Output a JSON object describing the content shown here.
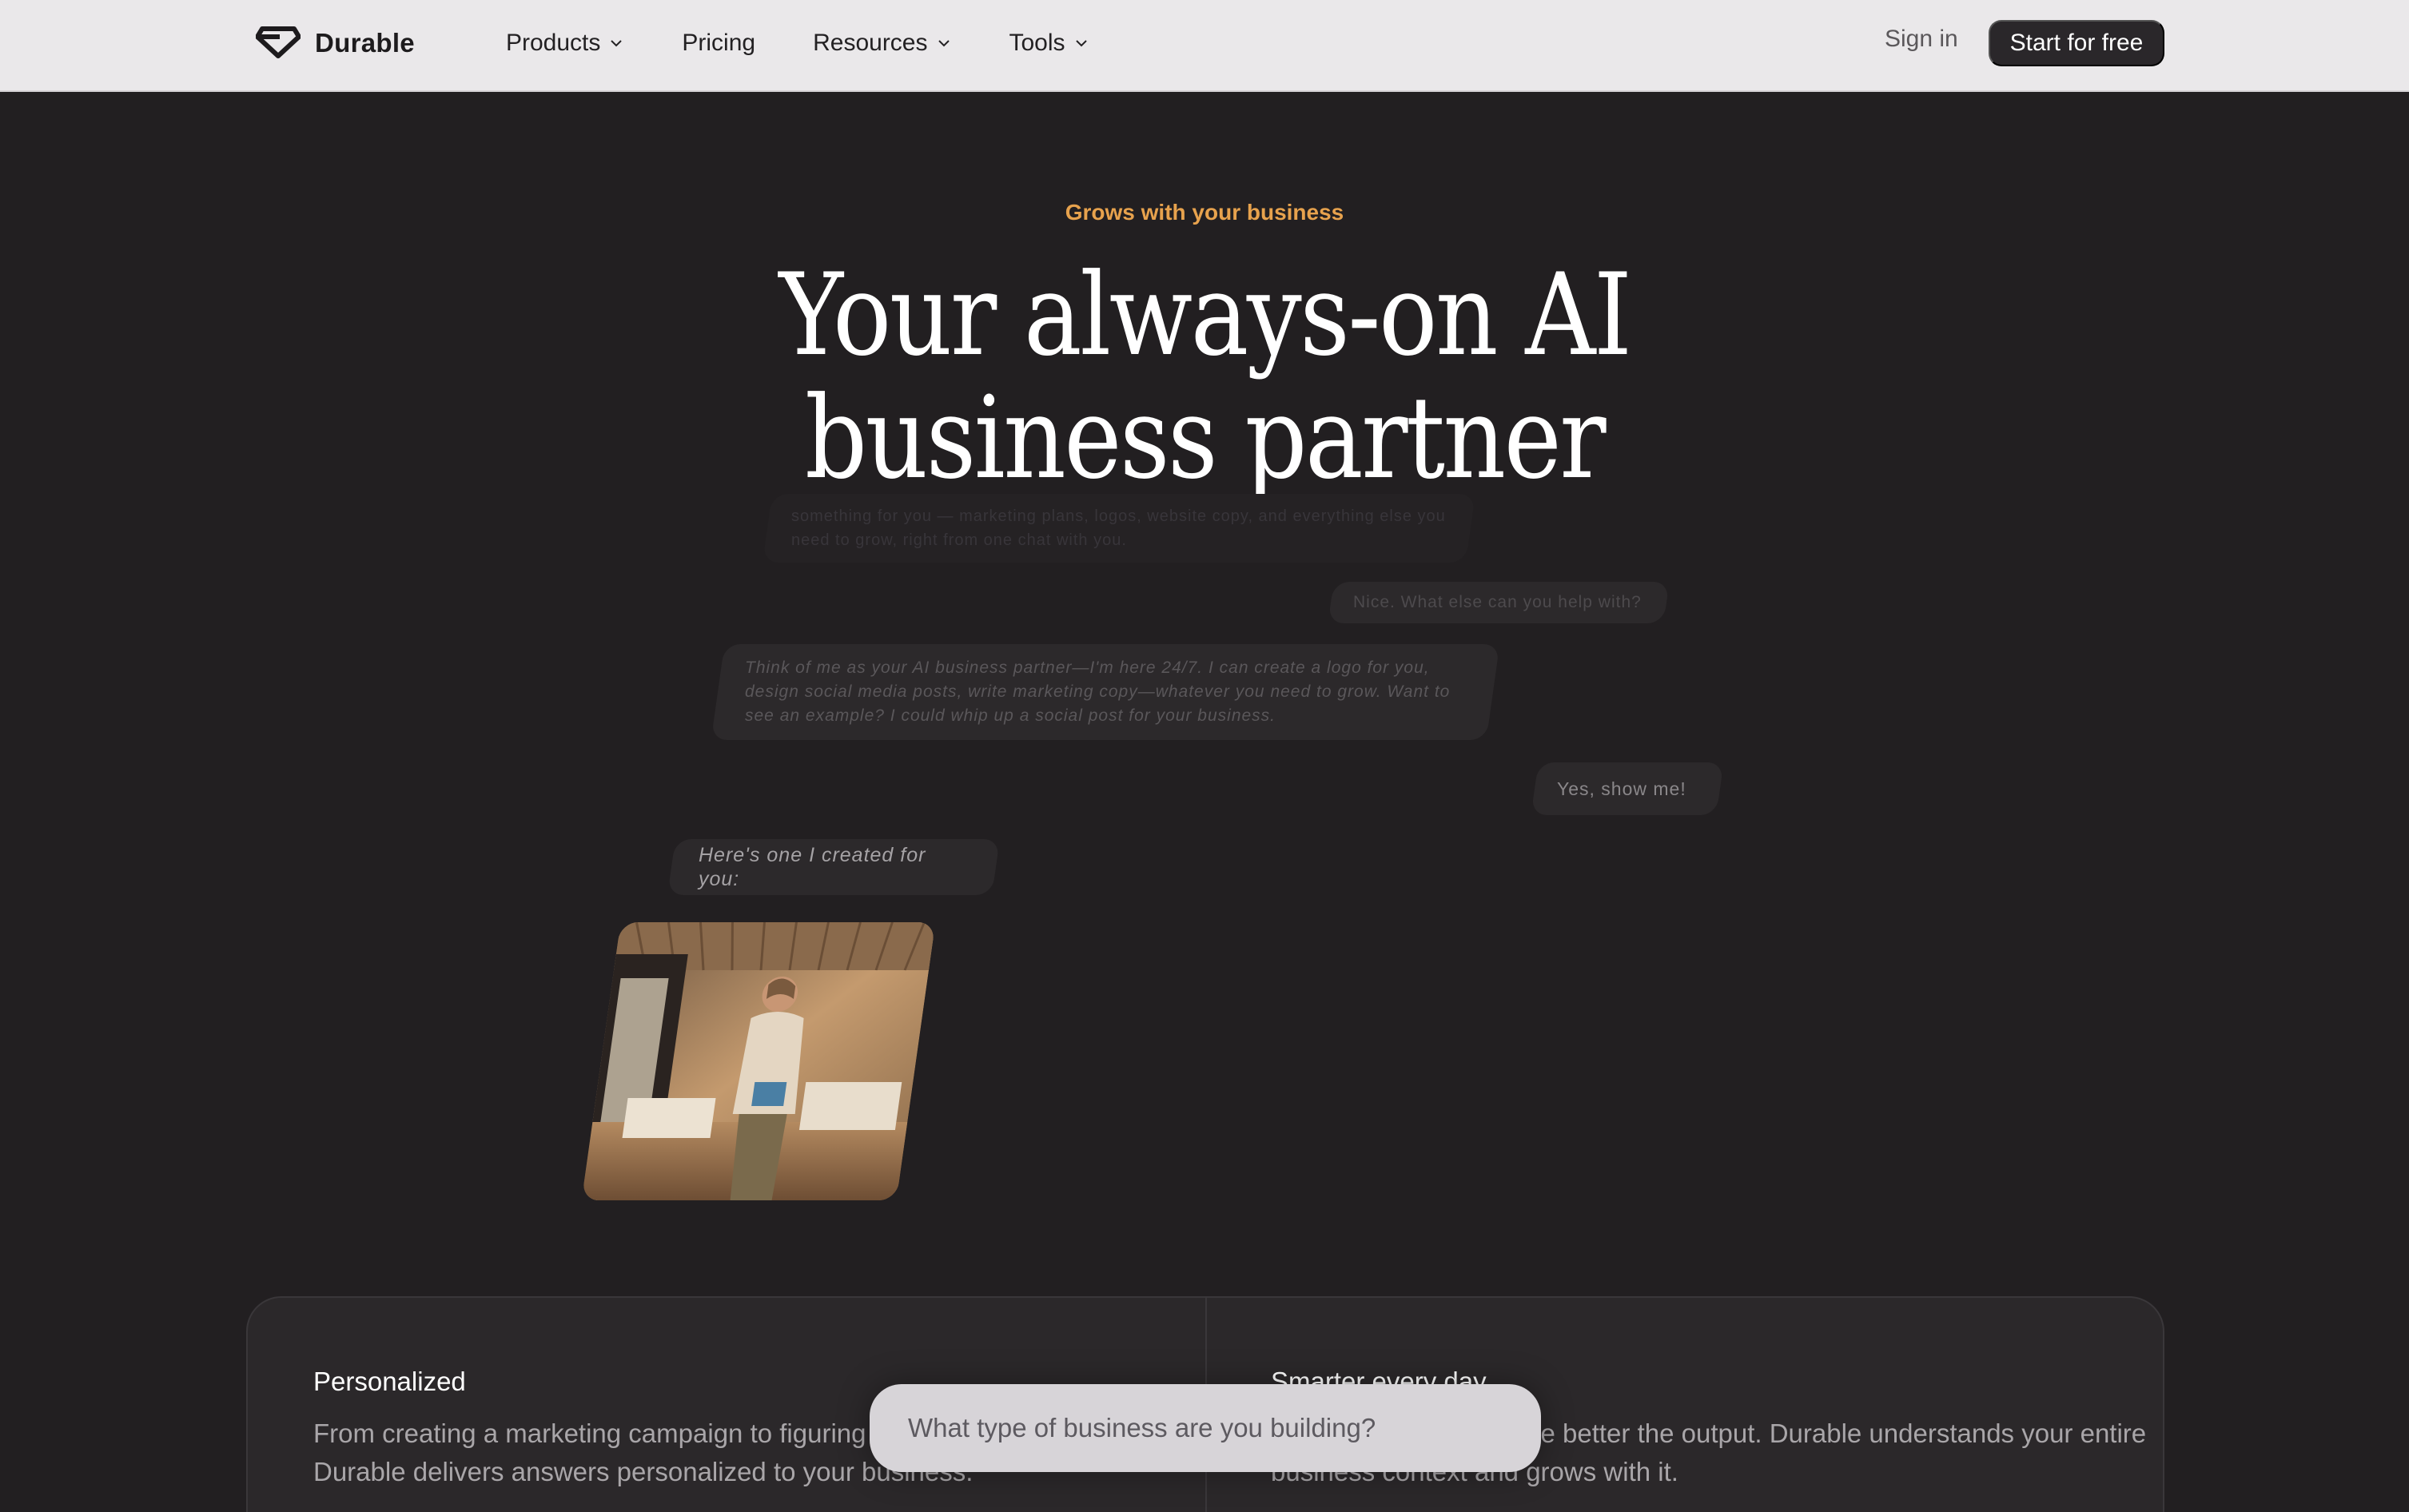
{
  "nav": {
    "brand": "Durable",
    "items": [
      {
        "label": "Products",
        "dropdown": true
      },
      {
        "label": "Pricing",
        "dropdown": false
      },
      {
        "label": "Resources",
        "dropdown": true
      },
      {
        "label": "Tools",
        "dropdown": true
      }
    ],
    "signin": "Sign in",
    "cta": "Start for free"
  },
  "hero": {
    "eyebrow": "Grows with your business",
    "title_line1": "Your always-on AI",
    "title_line2": "business partner"
  },
  "chat": {
    "faded_message": "something for you — marketing plans, logos, website copy, and everything else you need to grow, right from one chat with you.",
    "user_message_1": "Nice. What else can you help with?",
    "ai_message_1": "Think of me as your AI business partner—I'm here 24/7. I can create a logo for you, design social media posts, write marketing copy—whatever you need to grow. Want to see an example? I could whip up a social post for your business.",
    "user_message_2": "Yes, show me!",
    "ai_message_2": "Here's one I created for you:"
  },
  "features": [
    {
      "title": "Personalized",
      "text": "From creating a marketing campaign to figuring out your pricing strategy, Durable delivers answers personalized to your business."
    },
    {
      "title": "Smarter every day",
      "text": "The more you use it, the better the output. Durable understands your entire business context and grows with it."
    }
  ],
  "prompt": {
    "placeholder": "What type of business are you building?"
  },
  "colors": {
    "accent": "#e7a24d",
    "background": "#221f21",
    "nav_background": "#eae8ea"
  }
}
